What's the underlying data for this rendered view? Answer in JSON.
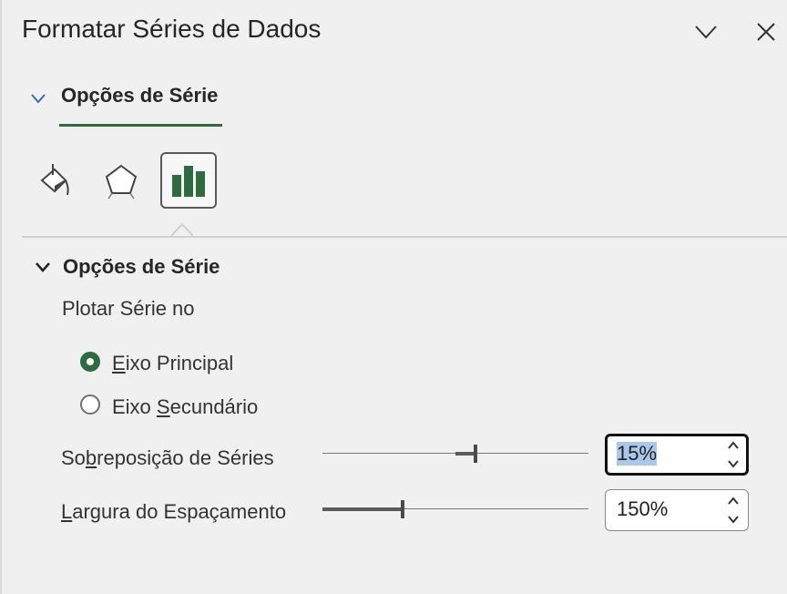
{
  "pane": {
    "title": "Formatar Séries de Dados",
    "collapse_icon": "chevron-down-icon",
    "close_icon": "close-icon"
  },
  "tab": {
    "label": "Opções de Série",
    "accent": "#2e6b3e"
  },
  "icon_tabs": [
    {
      "name": "fill-line-icon",
      "active": false
    },
    {
      "name": "effects-pentagon-icon",
      "active": false
    },
    {
      "name": "series-options-bar-chart-icon",
      "active": true
    }
  ],
  "section": {
    "title": "Opções de Série",
    "plot_on_label": "Plotar Série no",
    "radio_primary_a": "E",
    "radio_primary_b": "ixo Principal",
    "radio_secondary_a": "Eixo ",
    "radio_secondary_b": "S",
    "radio_secondary_c": "ecundário",
    "selected_axis": "primary"
  },
  "overlap": {
    "label_a": "So",
    "label_b": "b",
    "label_c": "reposição de Séries",
    "value": "15%",
    "level_percent": 57.5
  },
  "gap": {
    "label_a": "L",
    "label_b": "argura do Espaçamento",
    "value": "150%",
    "level_percent": 30
  }
}
